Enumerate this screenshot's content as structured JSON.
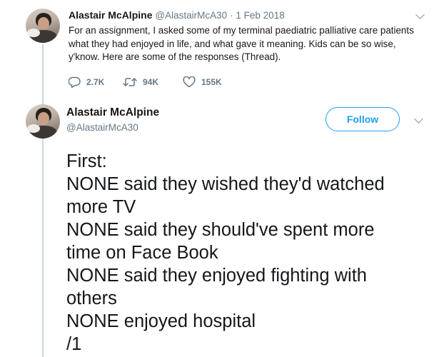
{
  "tweet1": {
    "name": "Alastair McAlpine",
    "handle": "@AlastairMcA30",
    "separator": "·",
    "date": "1 Feb 2018",
    "lines": [
      "For an assignment, I asked some of my terminal paediatric palliative care patients",
      "what they had enjoyed in life, and what gave it meaning. Kids can be so wise,",
      "y'know. Here are some of the responses (Thread)."
    ],
    "replies": "2.7K",
    "retweets": "94K",
    "likes": "155K",
    "icons": {
      "menu": "chevron-down-icon",
      "reply": "reply-icon",
      "retweet": "retweet-icon",
      "like": "heart-icon"
    }
  },
  "tweet2": {
    "name": "Alastair McAlpine",
    "handle": "@AlastairMcA30",
    "follow_label": "Follow",
    "lines": [
      "First:",
      "NONE said they wished they'd watched",
      "more TV",
      "NONE said they should've spent more",
      "time on Face Book",
      "NONE said they enjoyed fighting with",
      "others",
      "NONE enjoyed hospital",
      "/1"
    ],
    "icons": {
      "menu": "chevron-down-icon"
    }
  },
  "colors": {
    "accent": "#1da1f2",
    "secondary_text": "#657786",
    "thread_line": "#ccd6dd",
    "primary_text": "#14171a"
  }
}
